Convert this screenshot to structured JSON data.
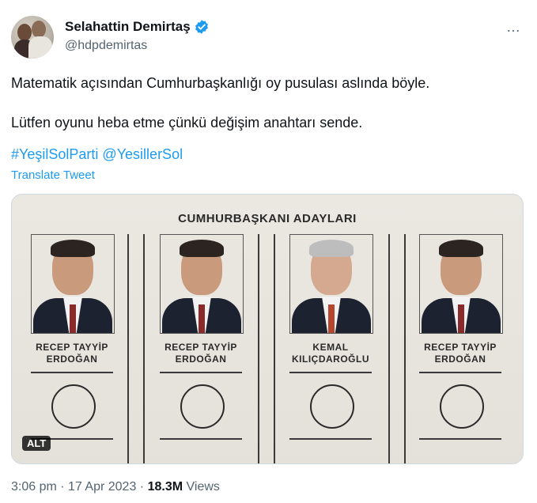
{
  "author": {
    "name": "Selahattin Demirtaş",
    "handle": "@hdpdemirtas"
  },
  "tweet": {
    "line1": "Matematik açısından Cumhurbaşkanlığı oy pusulası aslında böyle.",
    "line2": "Lütfen oyunu heba etme çünkü değişim anahtarı sende.",
    "hashtag1": "#YeşilSolParti",
    "hashtag2": "@YesillerSol",
    "translate_label": "Translate Tweet",
    "more_icon": "…",
    "alt_label": "ALT"
  },
  "ballot": {
    "title": "CUMHURBAŞKANI ADAYLARI",
    "candidates": [
      {
        "name_line1": "RECEP TAYYİP",
        "name_line2": "ERDOĞAN"
      },
      {
        "name_line1": "RECEP TAYYİP",
        "name_line2": "ERDOĞAN"
      },
      {
        "name_line1": "KEMAL",
        "name_line2": "KILIÇDAROĞLU"
      },
      {
        "name_line1": "RECEP TAYYİP",
        "name_line2": "ERDOĞAN"
      }
    ]
  },
  "meta": {
    "time": "3:06 pm",
    "sep": "·",
    "date": "17 Apr 2023",
    "views_count": "18.3M",
    "views_label": "Views"
  },
  "colors": {
    "link": "#1d9bf0",
    "secondary_text": "#536471",
    "verified": "#1d9bf0"
  },
  "icons": [
    "verified-badge-icon",
    "more-options-icon"
  ]
}
